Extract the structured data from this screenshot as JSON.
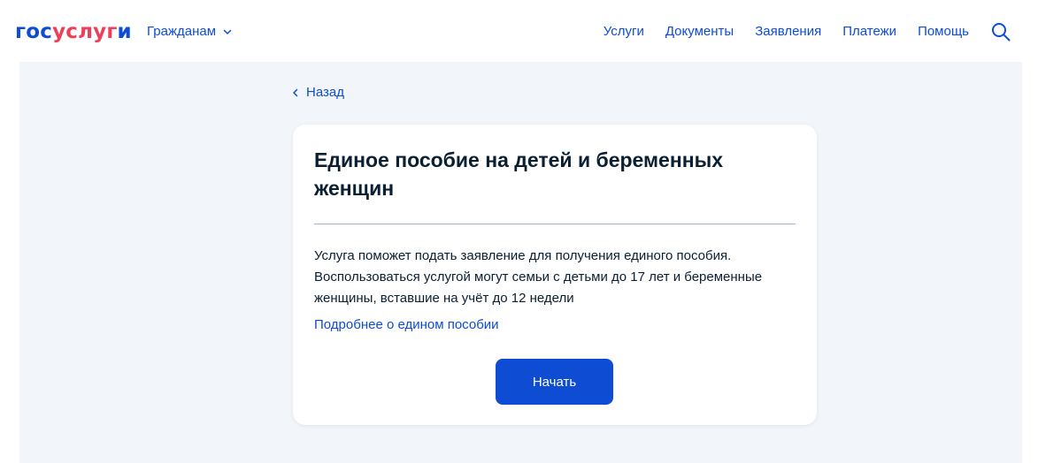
{
  "header": {
    "logo": {
      "part1": "гос",
      "part2": "услуг",
      "part3": "и"
    },
    "audience_label": "Гражданам",
    "nav": [
      {
        "label": "Услуги"
      },
      {
        "label": "Документы"
      },
      {
        "label": "Заявления"
      },
      {
        "label": "Платежи"
      },
      {
        "label": "Помощь"
      }
    ],
    "search_icon": "search-icon"
  },
  "back": {
    "label": "Назад"
  },
  "card": {
    "title": "Единое пособие на детей и беременных женщин",
    "description": "Услуга поможет подать заявление для получения единого пособия. Воспользоваться услугой могут семьи с детьми до 17 лет и беременные женщины, вставшие на учёт до 12 недели",
    "more_link": "Подробнее о едином пособии",
    "start_button": "Начать"
  },
  "colors": {
    "accent": "#0d4cd3",
    "logo_red": "#ee3f58",
    "text": "#0b1f33",
    "page_bg": "#f2f5fa",
    "divider": "#9ab6e8"
  }
}
